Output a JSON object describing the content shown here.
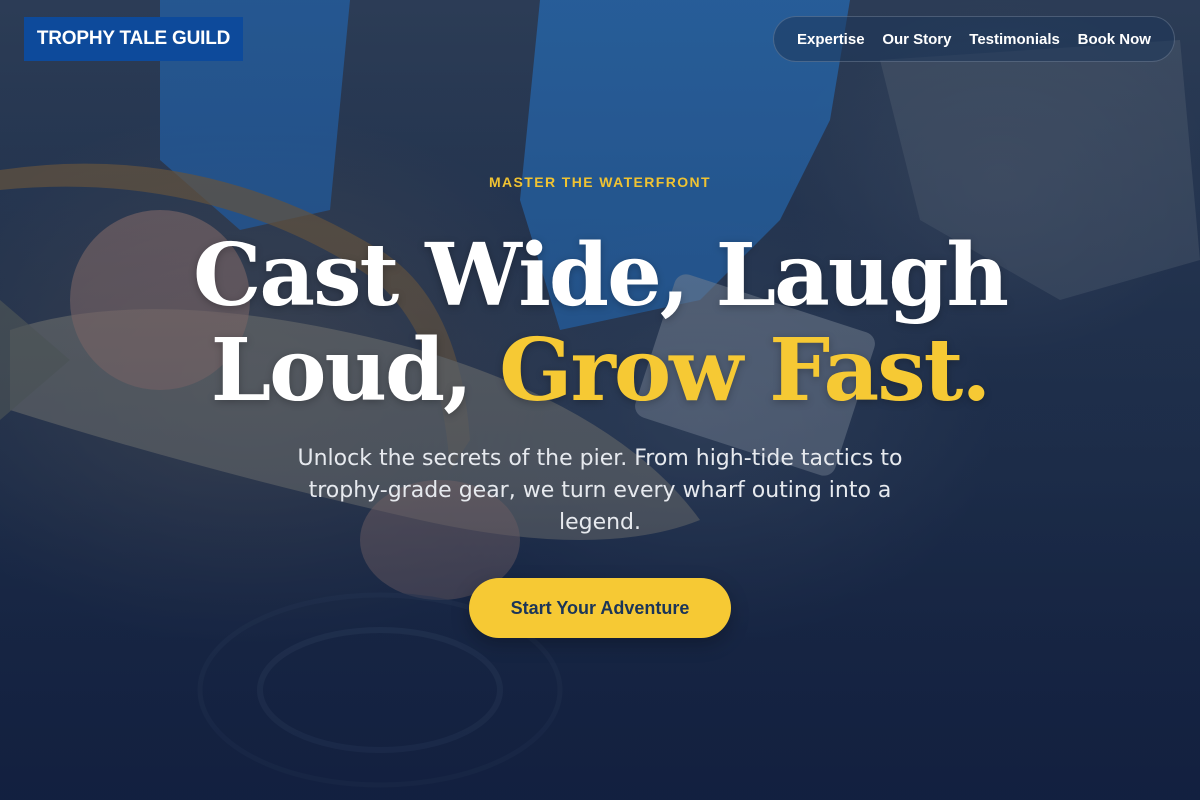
{
  "brand": {
    "name": "TROPHY TALE GUILD"
  },
  "nav": {
    "items": [
      {
        "label": "Expertise"
      },
      {
        "label": "Our Story"
      },
      {
        "label": "Testimonials"
      },
      {
        "label": "Book Now"
      }
    ]
  },
  "hero": {
    "eyebrow": "MASTER THE WATERFRONT",
    "headline_line1": "Cast Wide, Laugh",
    "headline_line2_plain": "Loud, ",
    "headline_line2_accent": "Grow Fast.",
    "subcopy": "Unlock the secrets of the pier. From high-tide tactics to trophy-grade gear, we turn every wharf outing into a legend.",
    "cta_label": "Start Your Adventure",
    "background_icon": "photo-angler-holding-trout"
  },
  "colors": {
    "brand_bg": "#0d4a9b",
    "accent": "#f6c934",
    "cta_text": "#1b3558",
    "eyebrow": "#f0c332"
  }
}
